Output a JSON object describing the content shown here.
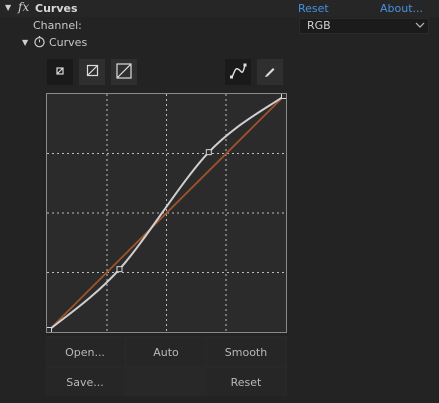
{
  "effect": {
    "name": "Curves",
    "reset_label": "Reset",
    "about_label": "About..."
  },
  "channel": {
    "label": "Channel:",
    "value": "RGB"
  },
  "curves_group": {
    "label": "Curves"
  },
  "buttons": {
    "open": "Open...",
    "auto": "Auto",
    "smooth": "Smooth",
    "save": "Save...",
    "reset": "Reset"
  },
  "colors": {
    "link": "#4a90e0",
    "curve": "#cfcfcf",
    "reference_line": "#a0522d",
    "grid": "#bdbdbd"
  },
  "curve_points": [
    [
      0,
      0
    ],
    [
      0.3,
      0.26
    ],
    [
      0.68,
      0.76
    ],
    [
      1,
      1
    ]
  ]
}
